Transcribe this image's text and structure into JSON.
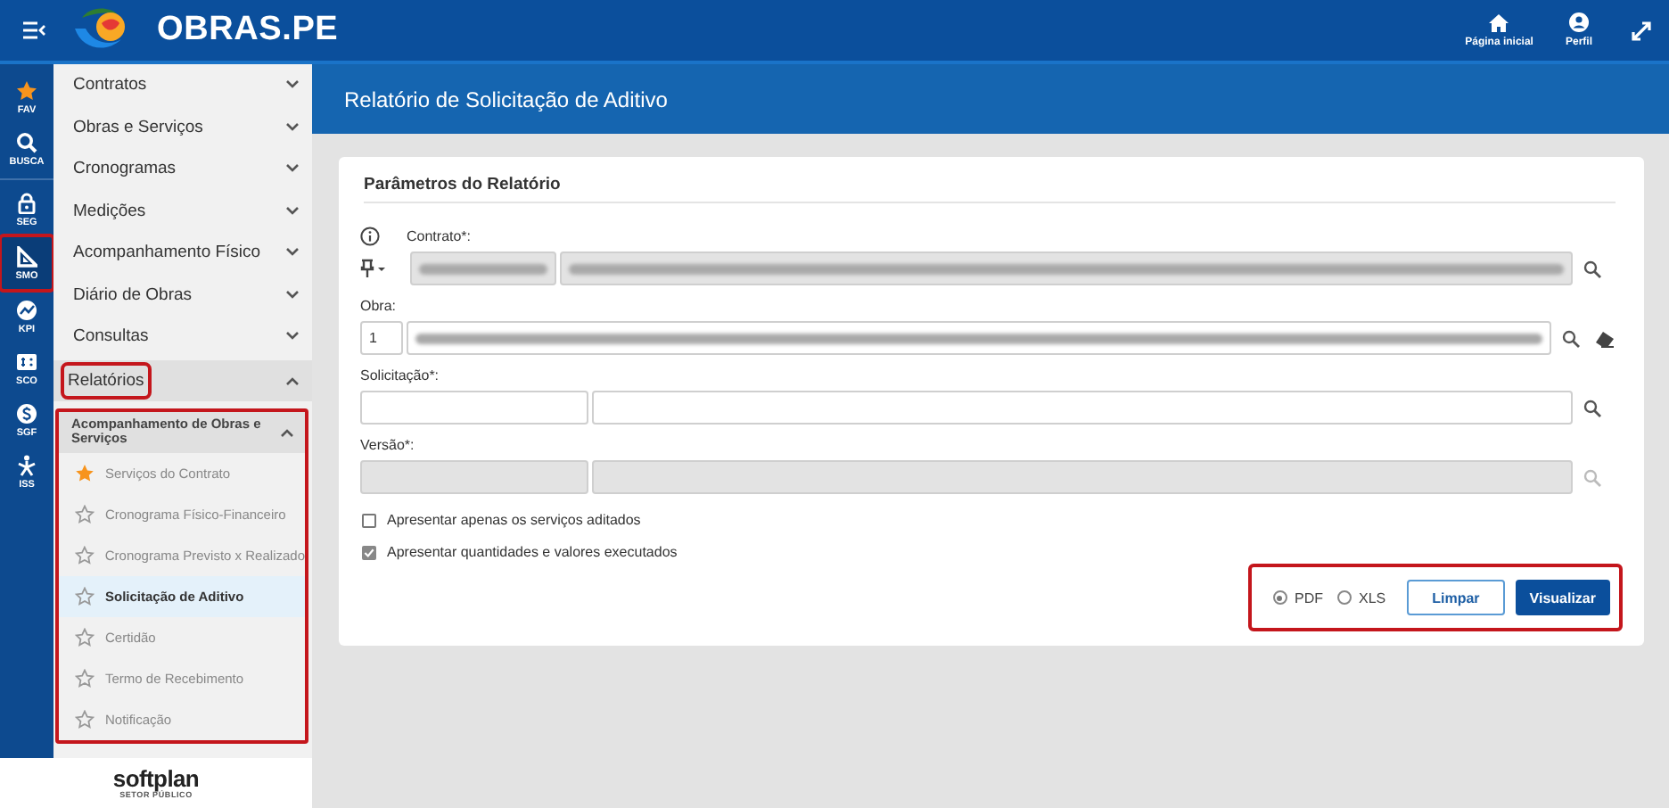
{
  "app": {
    "title": "OBRAS.PE",
    "actions": [
      {
        "kind": "home",
        "label": "Página inicial"
      },
      {
        "kind": "profile",
        "label": "Perfil"
      },
      {
        "kind": "expand"
      }
    ]
  },
  "rail": [
    {
      "kind": "star",
      "label": "FAV",
      "selected": false,
      "highlighted": false
    },
    {
      "kind": "search",
      "label": "BUSCA",
      "selected": false,
      "highlighted": false
    },
    {
      "kind": "lock",
      "label": "SEG",
      "selected": false,
      "highlighted": false
    },
    {
      "kind": "ruler",
      "label": "SMO",
      "selected": true,
      "highlighted": true
    },
    {
      "kind": "chart",
      "label": "KPI",
      "selected": false,
      "highlighted": false
    },
    {
      "kind": "money",
      "label": "SCO",
      "selected": false,
      "highlighted": false
    },
    {
      "kind": "dollar",
      "label": "SGF",
      "selected": false,
      "highlighted": false
    },
    {
      "kind": "person",
      "label": "ISS",
      "selected": false,
      "highlighted": false
    }
  ],
  "menu": [
    {
      "label": "Contratos",
      "expanded": false,
      "highlighted": false
    },
    {
      "label": "Obras e Serviços",
      "expanded": false,
      "highlighted": false
    },
    {
      "label": "Cronogramas",
      "expanded": false,
      "highlighted": false
    },
    {
      "label": "Medições",
      "expanded": false,
      "highlighted": false
    },
    {
      "label": "Acompanhamento Físico",
      "expanded": false,
      "highlighted": false
    },
    {
      "label": "Diário de Obras",
      "expanded": false,
      "highlighted": false
    },
    {
      "label": "Consultas",
      "expanded": false,
      "highlighted": false
    },
    {
      "label": "Relatórios",
      "expanded": true,
      "highlighted": true,
      "group": {
        "label": "Acompanhamento de Obras e Serviços",
        "expanded": true,
        "highlighted": true,
        "children": [
          {
            "label": "Serviços do Contrato",
            "favorite": true,
            "selected": false
          },
          {
            "label": "Cronograma Físico-Financeiro",
            "favorite": false,
            "selected": false
          },
          {
            "label": "Cronograma Previsto x Realizado",
            "favorite": false,
            "selected": false
          },
          {
            "label": "Solicitação de Aditivo",
            "favorite": false,
            "selected": true
          },
          {
            "label": "Certidão",
            "favorite": false,
            "selected": false
          },
          {
            "label": "Termo de Recebimento",
            "favorite": false,
            "selected": false
          },
          {
            "label": "Notificação",
            "favorite": false,
            "selected": false
          }
        ]
      }
    }
  ],
  "footer_logo": {
    "name": "softplan",
    "tagline": "SETOR PÚBLICO"
  },
  "page": {
    "title": "Relatório de Solicitação de Aditivo"
  },
  "form": {
    "title": "Parâmetros do Relatório",
    "fields": [
      {
        "label": "Contrato*:",
        "info": true,
        "pin": true,
        "code": {
          "blurred": true,
          "disabled": true
        },
        "description": {
          "blurred": true,
          "disabled": true
        },
        "search_enabled": true
      },
      {
        "label": "Obra:",
        "code": {
          "value": "1",
          "disabled": false
        },
        "description": {
          "blurred": true,
          "disabled": false
        },
        "search_enabled": true,
        "clear": true
      },
      {
        "label": "Solicitação*:",
        "code": {
          "disabled": false
        },
        "description": {
          "disabled": false
        },
        "search_enabled": true
      },
      {
        "label": "Versão*:",
        "code": {
          "disabled": true
        },
        "description": {
          "disabled": true
        },
        "search_enabled": false
      }
    ],
    "checkboxes": [
      {
        "label": "Apresentar apenas os serviços aditados",
        "checked": false
      },
      {
        "label": "Apresentar quantidades e valores executados",
        "checked": true
      }
    ],
    "output": {
      "highlighted": true,
      "formats": [
        {
          "label": "PDF",
          "selected": true
        },
        {
          "label": "XLS",
          "selected": false
        }
      ],
      "buttons": [
        {
          "label": "Limpar",
          "kind": "secondary"
        },
        {
          "label": "Visualizar",
          "kind": "primary"
        }
      ]
    }
  }
}
